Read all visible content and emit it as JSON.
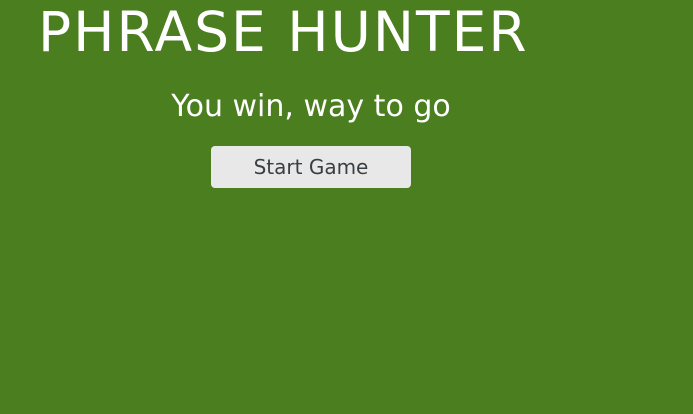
{
  "overlay": {
    "title": "PHRASE HUNTER",
    "message": "You win, way to go",
    "start_button_label": "Start Game"
  },
  "colors": {
    "background_win": "#4a7e1e",
    "title_text": "#ffffff",
    "button_background": "#e8e8e8",
    "button_text": "#3a3f44"
  }
}
